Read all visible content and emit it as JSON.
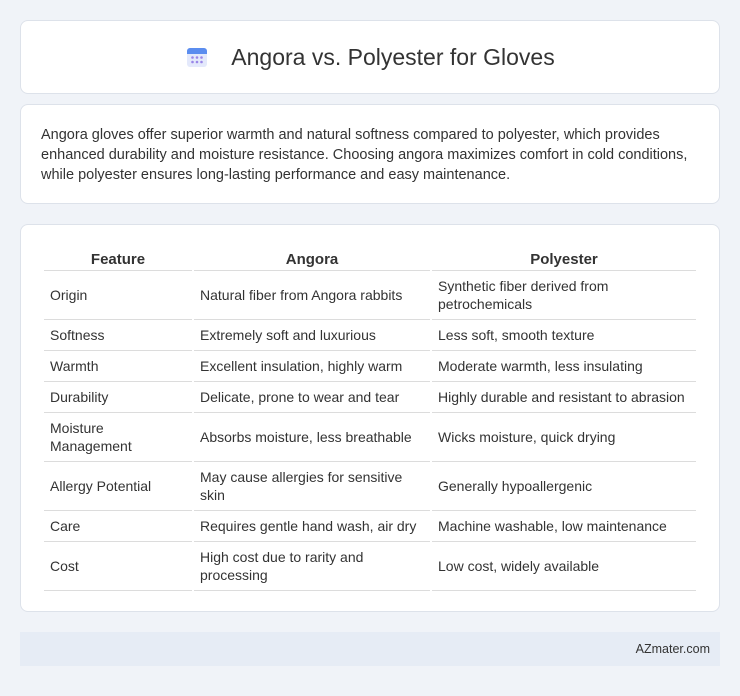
{
  "header": {
    "title": "Angora vs. Polyester for Gloves",
    "icon": "calendar-icon"
  },
  "intro": {
    "text": "Angora gloves offer superior warmth and natural softness compared to polyester, which provides enhanced durability and moisture resistance. Choosing angora maximizes comfort in cold conditions, while polyester ensures long-lasting performance and easy maintenance."
  },
  "table": {
    "headers": [
      "Feature",
      "Angora",
      "Polyester"
    ],
    "rows": [
      [
        "Origin",
        "Natural fiber from Angora rabbits",
        "Synthetic fiber derived from petrochemicals"
      ],
      [
        "Softness",
        "Extremely soft and luxurious",
        "Less soft, smooth texture"
      ],
      [
        "Warmth",
        "Excellent insulation, highly warm",
        "Moderate warmth, less insulating"
      ],
      [
        "Durability",
        "Delicate, prone to wear and tear",
        "Highly durable and resistant to abrasion"
      ],
      [
        "Moisture Management",
        "Absorbs moisture, less breathable",
        "Wicks moisture, quick drying"
      ],
      [
        "Allergy Potential",
        "May cause allergies for sensitive skin",
        "Generally hypoallergenic"
      ],
      [
        "Care",
        "Requires gentle hand wash, air dry",
        "Machine washable, low maintenance"
      ],
      [
        "Cost",
        "High cost due to rarity and processing",
        "Low cost, widely available"
      ]
    ]
  },
  "footer": {
    "site": "AZmater.com"
  },
  "colors": {
    "background": "#f0f3f8",
    "card": "#ffffff",
    "footer": "#e6ecf5",
    "icon_blue": "#4f8ef7",
    "icon_purple": "#8c7ae6"
  }
}
